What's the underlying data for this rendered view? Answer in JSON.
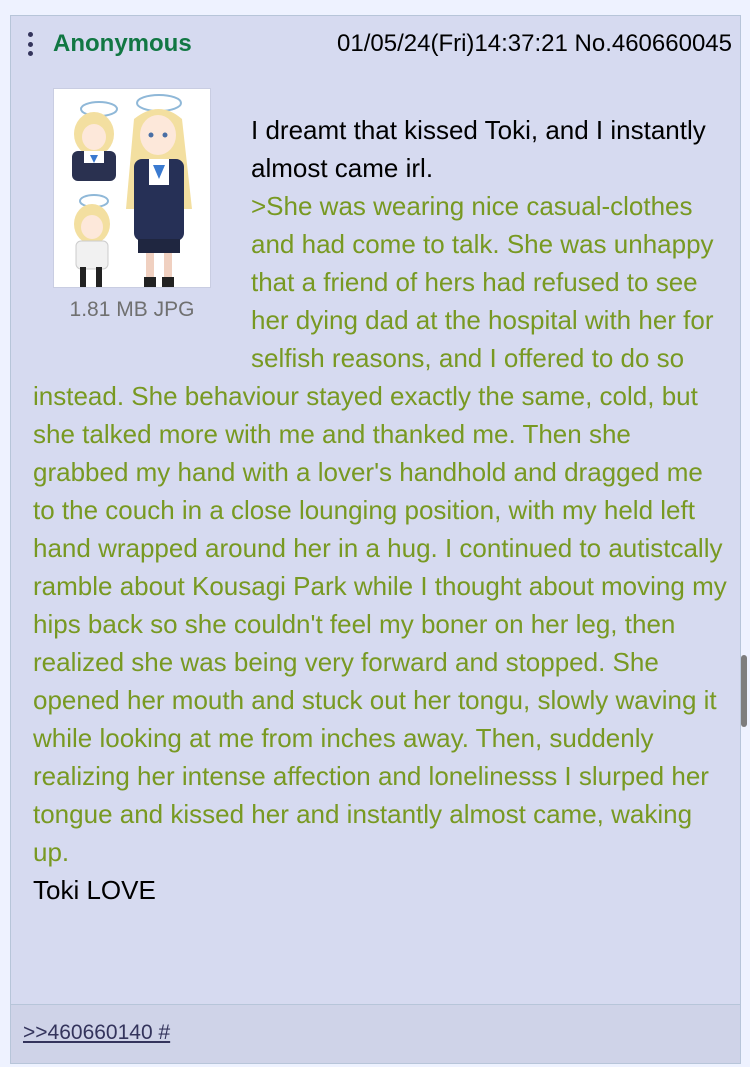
{
  "post": {
    "name": "Anonymous",
    "datetime": "01/05/24(Fri)14:37:21",
    "number": "No.460660045",
    "file_info": "1.81 MB JPG",
    "thumbnail_label": "anime girl illustration thumbnail",
    "line1": "I dreamt that kissed Toki, and I instantly almost came irl.",
    "greentext": ">She was wearing nice casual-clothes and had come to talk. She was unhappy that a friend of hers had refused to see her dying dad at the hospital with her for selfish reasons, and I offered to do so instead. She behaviour stayed exactly the same, cold, but she talked more with me and thanked me. Then she grabbed my hand with a lover's handhold and dragged me to the couch in a close lounging position, with my held left hand wrapped around her in a hug. I continued to autistcally ramble about Kousagi Park while I thought about moving my hips back so she couldn't feel my boner on her leg, then realized she was being very forward and stopped. She opened her mouth and stuck out her tongu, slowly waving it while looking at me from inches away. Then, suddenly realizing her intense affection and lonelinesss I slurped her tongue and kissed her and instantly almost came, waking up.",
    "closing": "Toki LOVE",
    "backlink": ">>460660140 #"
  },
  "colors": {
    "background": "#eef2ff",
    "post_bg": "#d6daf0",
    "name": "#117743",
    "greentext": "#789922",
    "link": "#34345c"
  },
  "icons": {
    "menu": "vertical-ellipsis-icon"
  }
}
